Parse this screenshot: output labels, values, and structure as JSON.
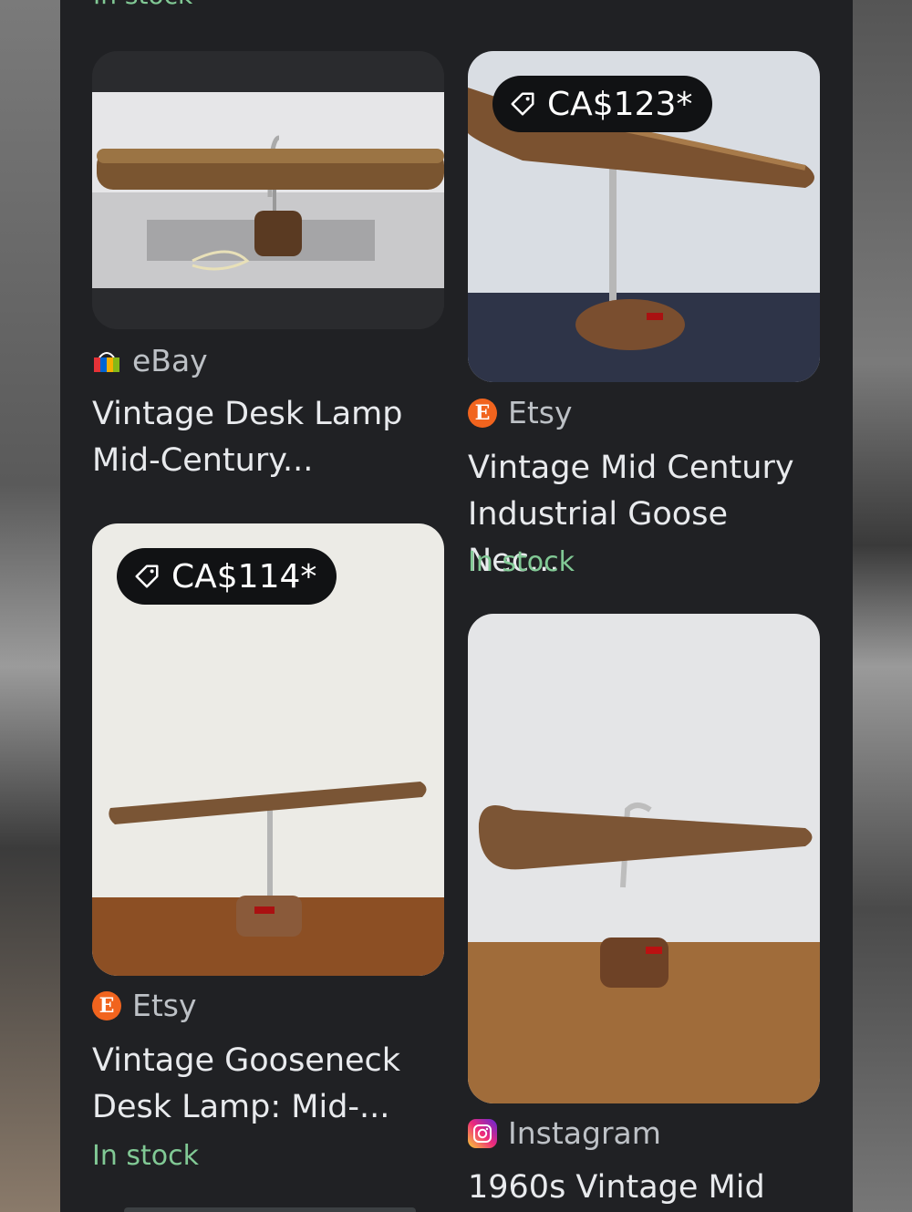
{
  "top_partial": {
    "left_text": "In stock"
  },
  "cards": [
    {
      "source": "eBay",
      "title_line1": "Vintage Desk Lamp",
      "title_line2": "Mid-Century...",
      "icon": "ebay-bag-icon"
    },
    {
      "price": "CA$123*",
      "source": "Etsy",
      "title_line1": "Vintage Mid Century",
      "title_line2": "Industrial Goose Nec...",
      "stock": "In stock",
      "icon": "etsy-icon"
    },
    {
      "price": "CA$114*",
      "source": "Etsy",
      "title_line1": "Vintage Gooseneck",
      "title_line2": "Desk Lamp: Mid-...",
      "stock": "In stock",
      "icon": "etsy-icon"
    },
    {
      "source": "Instagram",
      "title_line1": "1960s Vintage Mid",
      "icon": "instagram-icon"
    }
  ],
  "colors": {
    "panel_bg": "#202124",
    "stock_green": "#81c995",
    "etsy_orange": "#f1641e"
  }
}
